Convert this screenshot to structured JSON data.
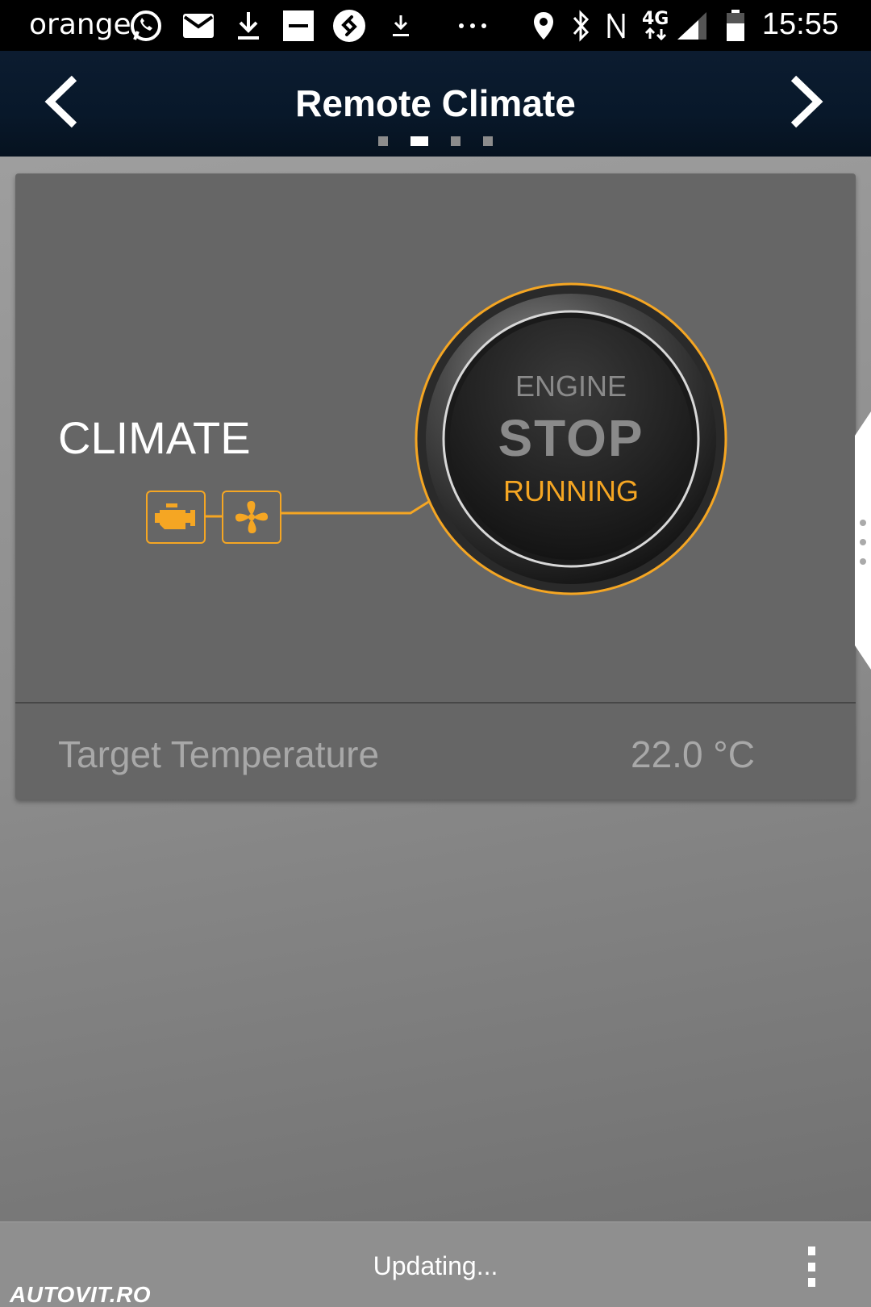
{
  "status_bar": {
    "carrier": "orange",
    "network": "4G",
    "time": "15:55",
    "icons": [
      "whatsapp-icon",
      "mail-icon",
      "download-icon",
      "minus-box-icon",
      "shazam-icon",
      "download-small-icon",
      "more-dots-icon",
      "location-icon",
      "bluetooth-icon",
      "nfc-icon",
      "network-4g-icon",
      "signal-icon",
      "battery-icon"
    ]
  },
  "header": {
    "title": "Remote Climate",
    "page_count": 4,
    "active_page": 1
  },
  "card": {
    "climate_label": "CLIMATE",
    "engine_button": {
      "line1": "ENGINE",
      "line2": "STOP",
      "line3": "RUNNING"
    },
    "target_temperature": {
      "label": "Target Temperature",
      "value": "22.0 °C"
    },
    "icons": [
      "engine-icon",
      "fan-icon"
    ]
  },
  "bottom_bar": {
    "status": "Updating...",
    "watermark": "AUTOVIT.RO"
  },
  "colors": {
    "accent": "#f5a623",
    "header_bg": "#0a1a2c",
    "card_bg": "#666666",
    "muted_text": "#a8a8a8"
  }
}
